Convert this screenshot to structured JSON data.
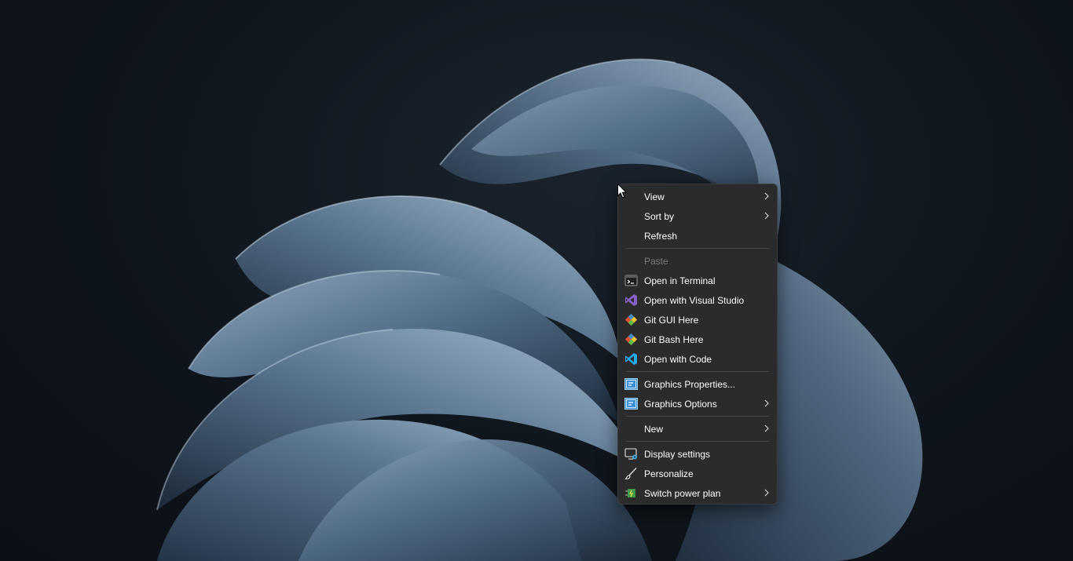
{
  "desktop": {
    "background_color": "#0f151c",
    "wallpaper": "windows-11-bloom-dark"
  },
  "context_menu": {
    "background": "#2b2b2b",
    "items": [
      {
        "label": "View",
        "icon": "",
        "submenu": true
      },
      {
        "label": "Sort by",
        "icon": "",
        "submenu": true
      },
      {
        "label": "Refresh",
        "icon": "",
        "submenu": false
      },
      {
        "label": "Paste",
        "icon": "",
        "submenu": false,
        "disabled": true
      },
      {
        "label": "Open in Terminal",
        "icon": "terminal-icon",
        "submenu": false
      },
      {
        "label": "Open with Visual Studio",
        "icon": "visual-studio-icon",
        "submenu": false
      },
      {
        "label": "Git GUI Here",
        "icon": "git-gui-icon",
        "submenu": false
      },
      {
        "label": "Git Bash Here",
        "icon": "git-bash-icon",
        "submenu": false
      },
      {
        "label": "Open with Code",
        "icon": "vscode-icon",
        "submenu": false
      },
      {
        "label": "Graphics Properties...",
        "icon": "intel-graphics-icon",
        "submenu": false
      },
      {
        "label": "Graphics Options",
        "icon": "intel-graphics-icon",
        "submenu": true
      },
      {
        "label": "New",
        "icon": "",
        "submenu": true
      },
      {
        "label": "Display settings",
        "icon": "display-settings-icon",
        "submenu": false
      },
      {
        "label": "Personalize",
        "icon": "brush-icon",
        "submenu": false
      },
      {
        "label": "Switch power plan",
        "icon": "power-plan-icon",
        "submenu": true
      }
    ]
  },
  "colors": {
    "text": "#ffffff",
    "disabled_text": "#7a7a7a",
    "separator": "#474747",
    "visual_studio": "#8661c5",
    "vscode": "#23a9f2",
    "git": "#f05133"
  }
}
